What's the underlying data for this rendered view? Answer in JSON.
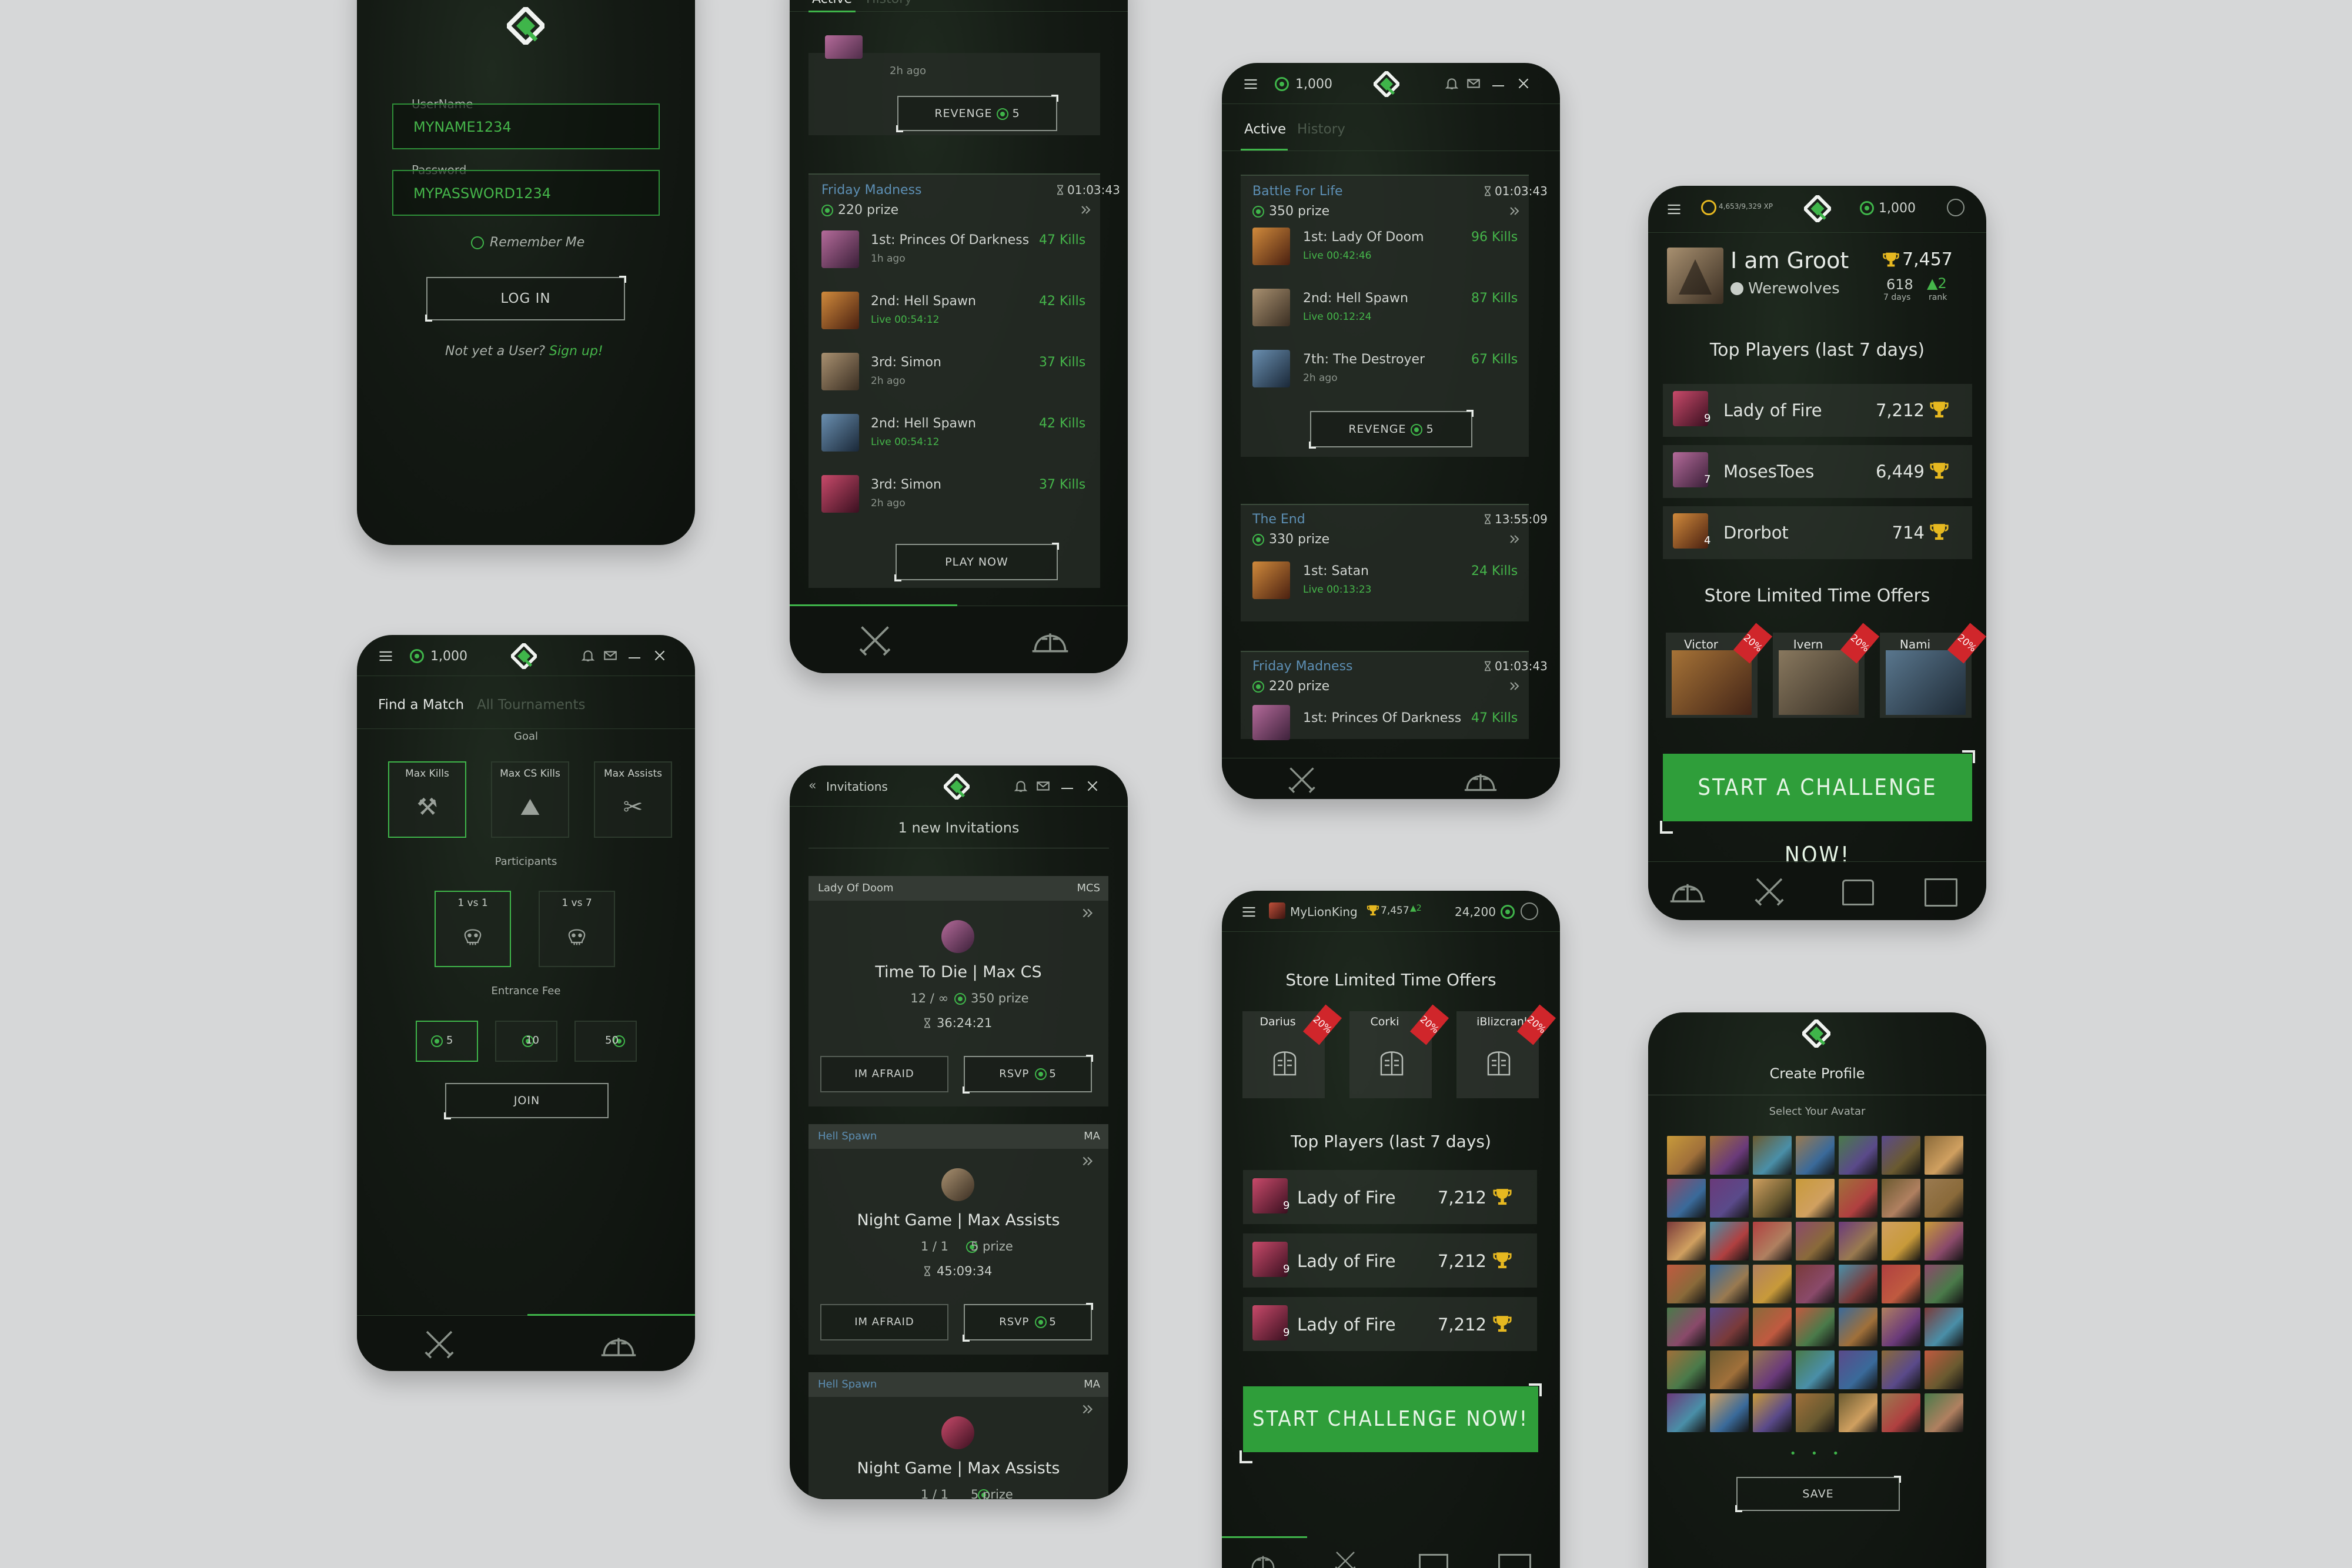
{
  "login": {
    "username_label": "UserName",
    "username_value": "MYNAME1234",
    "password_label": "Password",
    "password_value": "MYPASSWORD1234",
    "remember": "Remember Me",
    "login_button": "LOG IN",
    "signup_prefix": "Not yet a User?",
    "signup_link": "Sign up!"
  },
  "active1": {
    "tabs": [
      "Active",
      "History"
    ],
    "top_time": "2h ago",
    "revenge_label": "REVENGE",
    "revenge_cost": "5",
    "tournament": {
      "name": "Friday Madness",
      "timer": "01:03:43",
      "prize": "220 prize"
    },
    "rows": [
      {
        "place": "1st: Princes Of Darkness",
        "kills": "47 Kills",
        "time": "1h ago",
        "live": false
      },
      {
        "place": "2nd: Hell Spawn",
        "kills": "42 Kills",
        "time": "Live 00:54:12",
        "live": true
      },
      {
        "place": "3rd: Simon",
        "kills": "37 Kills",
        "time": "2h ago",
        "live": false
      },
      {
        "place": "2nd: Hell Spawn",
        "kills": "42 Kills",
        "time": "Live 00:54:12",
        "live": true
      },
      {
        "place": "3rd: Simon",
        "kills": "37 Kills",
        "time": "2h ago",
        "live": false
      }
    ],
    "play_now": "PLAY NOW"
  },
  "active2": {
    "balance": "1,000",
    "tabs": [
      "Active",
      "History"
    ],
    "t1": {
      "name": "Battle For Life",
      "timer": "01:03:43",
      "prize": "350 prize"
    },
    "t1_rows": [
      {
        "place": "1st: Lady Of Doom",
        "kills": "96 Kills",
        "time": "Live 00:42:46",
        "live": true
      },
      {
        "place": "2nd: Hell Spawn",
        "kills": "87 Kills",
        "time": "Live 00:12:24",
        "live": true
      },
      {
        "place": "7th: The Destroyer",
        "kills": "67 Kills",
        "time": "2h ago",
        "live": false
      }
    ],
    "revenge_label": "REVENGE",
    "revenge_cost": "5",
    "t2": {
      "name": "The End",
      "timer": "13:55:09",
      "prize": "330 prize"
    },
    "t2_rows": [
      {
        "place": "1st: Satan",
        "kills": "24 Kills",
        "time": "Live 00:13:23",
        "live": true
      }
    ],
    "t3": {
      "name": "Friday Madness",
      "timer": "01:03:43",
      "prize": "220 prize"
    },
    "t3_rows": [
      {
        "place": "1st: Princes Of Darkness",
        "kills": "47 Kills"
      }
    ]
  },
  "profile": {
    "xp": "4,653/9,329 XP",
    "balance": "1,000",
    "name": "I am Groot",
    "team": "Werewolves",
    "points": "7,457",
    "days_val": "618",
    "days_label": "7 days",
    "rank_val": "2",
    "rank_label": "rank",
    "top_title": "Top Players (last 7 days)",
    "players": [
      {
        "name": "Lady of Fire",
        "score": "7,212",
        "level": "9"
      },
      {
        "name": "MosesToes",
        "score": "6,449",
        "level": "7"
      },
      {
        "name": "Drorbot",
        "score": "714",
        "level": "4"
      }
    ],
    "store_title": "Store Limited Time Offers",
    "offers": [
      {
        "name": "Victor",
        "badge": "20%"
      },
      {
        "name": "Ivern",
        "badge": "20%"
      },
      {
        "name": "Nami",
        "badge": "20%"
      }
    ],
    "cta": "START A CHALLENGE NOW!"
  },
  "match": {
    "balance": "1,000",
    "tabs": [
      "Find a Match",
      "All Tournaments"
    ],
    "goal_label": "Goal",
    "goals": [
      "Max Kills",
      "Max CS Kills",
      "Max Assists"
    ],
    "participants_label": "Participants",
    "participants": [
      "1 vs 1",
      "1 vs 7"
    ],
    "fee_label": "Entrance Fee",
    "fees": [
      "5",
      "10",
      "50"
    ],
    "join": "JOIN"
  },
  "invites": {
    "back_label": "Invitations",
    "banner": "1 new Invitations",
    "cards": [
      {
        "from": "Lady Of Doom",
        "mode": "MCS",
        "title": "Time To Die | Max CS",
        "slots": "12 / ∞",
        "prize": "350 prize",
        "timer": "36:24:21",
        "decline": "IM AFRAID",
        "accept": "RSVP",
        "cost": "5"
      },
      {
        "from": "Hell Spawn",
        "mode": "MA",
        "title": "Night Game | Max Assists",
        "slots": "1 / 1",
        "prize": "5 prize",
        "timer": "45:09:34",
        "decline": "IM AFRAID",
        "accept": "RSVP",
        "cost": "5"
      },
      {
        "from": "Hell Spawn",
        "mode": "MA",
        "title": "Night Game | Max Assists",
        "slots": "1 / 1",
        "prize": "5 prize"
      }
    ]
  },
  "home": {
    "user": "MyLionKing",
    "points": "7,457",
    "rank": "2",
    "balance": "24,200",
    "store_title": "Store Limited Time Offers",
    "offers": [
      {
        "name": "Darius",
        "badge": "20%"
      },
      {
        "name": "Corki",
        "badge": "20%"
      },
      {
        "name": "iBlizcrank",
        "badge": "20%"
      }
    ],
    "top_title": "Top Players (last 7 days)",
    "players": [
      {
        "name": "Lady of Fire",
        "score": "7,212",
        "level": "9"
      },
      {
        "name": "Lady of Fire",
        "score": "7,212",
        "level": "9"
      },
      {
        "name": "Lady of Fire",
        "score": "7,212",
        "level": "9"
      }
    ],
    "cta": "START CHALLENGE NOW!"
  },
  "create": {
    "title": "Create Profile",
    "subtitle": "Select Your Avatar",
    "save": "SAVE"
  },
  "colors": {
    "accent": "#3fb54a",
    "bg": "#d6d7d8",
    "panel": "#141a14",
    "live": "#3fb54a",
    "badge": "#d0262b"
  }
}
